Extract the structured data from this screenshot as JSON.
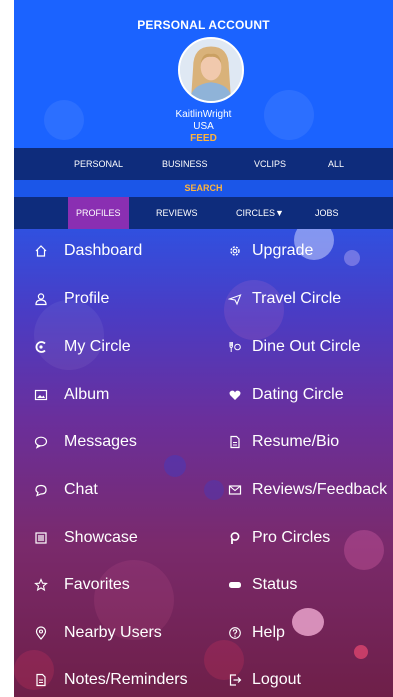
{
  "header": {
    "title": "PERSONAL ACCOUNT",
    "username": "KaitlinWright",
    "country": "USA",
    "feed_label": "FEED"
  },
  "top_tabs": [
    "PERSONAL",
    "BUSINESS",
    "VCLIPS",
    "ALL"
  ],
  "search_label": "SEARCH",
  "sub_tabs": {
    "profiles": "PROFILES",
    "reviews": "REVIEWS",
    "circles": "CIRCLES▼",
    "jobs": "JOBS"
  },
  "menu_left": [
    {
      "label": "Dashboard",
      "icon": "home-icon"
    },
    {
      "label": "Profile",
      "icon": "user-icon"
    },
    {
      "label": "My Circle",
      "icon": "circle-icon"
    },
    {
      "label": "Album",
      "icon": "image-icon"
    },
    {
      "label": "Messages",
      "icon": "message-icon"
    },
    {
      "label": "Chat",
      "icon": "chat-icon"
    },
    {
      "label": "Showcase",
      "icon": "showcase-icon"
    },
    {
      "label": "Favorites",
      "icon": "star-icon"
    },
    {
      "label": "Nearby Users",
      "icon": "location-icon"
    },
    {
      "label": "Notes/Reminders",
      "icon": "note-icon"
    }
  ],
  "menu_right": [
    {
      "label": "Upgrade",
      "icon": "settings-icon"
    },
    {
      "label": "Travel Circle",
      "icon": "plane-icon"
    },
    {
      "label": "Dine Out Circle",
      "icon": "dining-icon"
    },
    {
      "label": "Dating Circle",
      "icon": "heart-icon"
    },
    {
      "label": "Resume/Bio",
      "icon": "document-icon"
    },
    {
      "label": "Reviews/Feedback",
      "icon": "mail-icon"
    },
    {
      "label": "Pro Circles",
      "icon": "pro-circle-icon"
    },
    {
      "label": "Status",
      "icon": "status-icon"
    },
    {
      "label": "Help",
      "icon": "help-icon"
    },
    {
      "label": "Logout",
      "icon": "logout-icon"
    }
  ]
}
